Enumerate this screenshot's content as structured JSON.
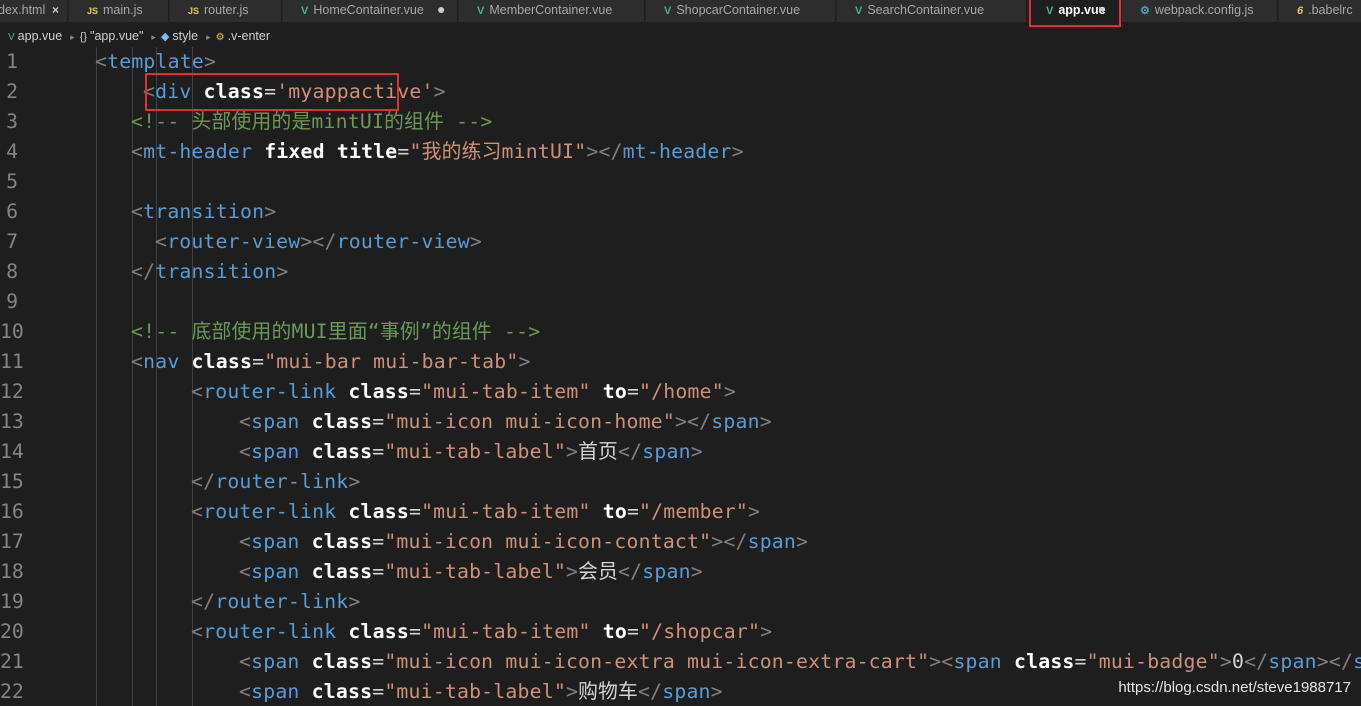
{
  "tabs": [
    {
      "label": "dex.html",
      "icon": "html-file-icon",
      "close": "×"
    },
    {
      "label": "main.js",
      "icon": "js-file-icon",
      "icon_text": "JS"
    },
    {
      "label": "router.js",
      "icon": "js-file-icon",
      "icon_text": "JS"
    },
    {
      "label": "HomeContainer.vue",
      "icon": "vue-file-icon",
      "icon_text": "V",
      "dirty": "●"
    },
    {
      "label": "MemberContainer.vue",
      "icon": "vue-file-icon",
      "icon_text": "V"
    },
    {
      "label": "ShopcarContainer.vue",
      "icon": "vue-file-icon",
      "icon_text": "V"
    },
    {
      "label": "SearchContainer.vue",
      "icon": "vue-file-icon",
      "icon_text": "V"
    },
    {
      "label": "app.vue",
      "icon": "vue-file-icon",
      "icon_text": "V",
      "close": "×",
      "active": true
    },
    {
      "label": "webpack.config.js",
      "icon": "gear-file-icon",
      "icon_text": "⚙"
    },
    {
      "label": ".babelrc",
      "icon": "babel-file-icon",
      "icon_text": "6"
    }
  ],
  "breadcrumb": {
    "file_icon": "V",
    "file": "app.vue",
    "block_icon": "{}",
    "block": "\"app.vue\"",
    "style_icon": "◆",
    "style": "style",
    "selector_icon": "⚙",
    "selector": ".v-enter",
    "separator": "▸"
  },
  "colors": {
    "background": "#1e1e1e",
    "tag": "#569cd6",
    "string": "#ce9178",
    "comment": "#6a9955",
    "attribute": "#ffffff",
    "highlight_box": "#e03030"
  },
  "code": {
    "lines": [
      {
        "num": "1",
        "tokens": [
          [
            "p",
            "<"
          ],
          [
            "t",
            "template"
          ],
          [
            "p",
            ">"
          ]
        ]
      },
      {
        "num": "2",
        "tokens": [
          [
            "p",
            "<"
          ],
          [
            "t",
            "div"
          ],
          [
            "x",
            " "
          ],
          [
            "a",
            "class"
          ],
          [
            "e",
            "="
          ],
          [
            "s",
            "'myappactive'"
          ],
          [
            "p",
            ">"
          ]
        ]
      },
      {
        "num": "3",
        "tokens": [
          [
            "c",
            "<!-- 头部使用的是mintUI的组件 -->"
          ]
        ]
      },
      {
        "num": "4",
        "tokens": [
          [
            "p",
            "<"
          ],
          [
            "t",
            "mt-header"
          ],
          [
            "x",
            " "
          ],
          [
            "a",
            "fixed"
          ],
          [
            "x",
            " "
          ],
          [
            "a",
            "title"
          ],
          [
            "e",
            "="
          ],
          [
            "s",
            "\"我的练习mintUI\""
          ],
          [
            "p",
            ">"
          ],
          [
            "p",
            "</"
          ],
          [
            "t",
            "mt-header"
          ],
          [
            "p",
            ">"
          ]
        ]
      },
      {
        "num": "5",
        "tokens": []
      },
      {
        "num": "6",
        "tokens": [
          [
            "p",
            "<"
          ],
          [
            "t",
            "transition"
          ],
          [
            "p",
            ">"
          ]
        ]
      },
      {
        "num": "7",
        "tokens": [
          [
            "p",
            "<"
          ],
          [
            "t",
            "router-view"
          ],
          [
            "p",
            ">"
          ],
          [
            "p",
            "</"
          ],
          [
            "t",
            "router-view"
          ],
          [
            "p",
            ">"
          ]
        ]
      },
      {
        "num": "8",
        "tokens": [
          [
            "p",
            "</"
          ],
          [
            "t",
            "transition"
          ],
          [
            "p",
            ">"
          ]
        ]
      },
      {
        "num": "9",
        "tokens": []
      },
      {
        "num": "10",
        "tokens": [
          [
            "c",
            "<!-- 底部使用的MUI里面“事例”的组件 -->"
          ]
        ]
      },
      {
        "num": "11",
        "tokens": [
          [
            "p",
            "<"
          ],
          [
            "t",
            "nav"
          ],
          [
            "x",
            " "
          ],
          [
            "a",
            "class"
          ],
          [
            "e",
            "="
          ],
          [
            "s",
            "\"mui-bar mui-bar-tab\""
          ],
          [
            "p",
            ">"
          ]
        ]
      },
      {
        "num": "12",
        "tokens": [
          [
            "p",
            "<"
          ],
          [
            "t",
            "router-link"
          ],
          [
            "x",
            " "
          ],
          [
            "a",
            "class"
          ],
          [
            "e",
            "="
          ],
          [
            "s",
            "\"mui-tab-item\""
          ],
          [
            "x",
            " "
          ],
          [
            "a",
            "to"
          ],
          [
            "e",
            "="
          ],
          [
            "s",
            "\"/home\""
          ],
          [
            "p",
            ">"
          ]
        ]
      },
      {
        "num": "13",
        "tokens": [
          [
            "p",
            "<"
          ],
          [
            "t",
            "span"
          ],
          [
            "x",
            " "
          ],
          [
            "a",
            "class"
          ],
          [
            "e",
            "="
          ],
          [
            "s",
            "\"mui-icon mui-icon-home\""
          ],
          [
            "p",
            ">"
          ],
          [
            "p",
            "</"
          ],
          [
            "t",
            "span"
          ],
          [
            "p",
            ">"
          ]
        ]
      },
      {
        "num": "14",
        "tokens": [
          [
            "p",
            "<"
          ],
          [
            "t",
            "span"
          ],
          [
            "x",
            " "
          ],
          [
            "a",
            "class"
          ],
          [
            "e",
            "="
          ],
          [
            "s",
            "\"mui-tab-label\""
          ],
          [
            "p",
            ">"
          ],
          [
            "x",
            "首页"
          ],
          [
            "p",
            "</"
          ],
          [
            "t",
            "span"
          ],
          [
            "p",
            ">"
          ]
        ]
      },
      {
        "num": "15",
        "tokens": [
          [
            "p",
            "</"
          ],
          [
            "t",
            "router-link"
          ],
          [
            "p",
            ">"
          ]
        ]
      },
      {
        "num": "16",
        "tokens": [
          [
            "p",
            "<"
          ],
          [
            "t",
            "router-link"
          ],
          [
            "x",
            " "
          ],
          [
            "a",
            "class"
          ],
          [
            "e",
            "="
          ],
          [
            "s",
            "\"mui-tab-item\""
          ],
          [
            "x",
            " "
          ],
          [
            "a",
            "to"
          ],
          [
            "e",
            "="
          ],
          [
            "s",
            "\"/member\""
          ],
          [
            "p",
            ">"
          ]
        ]
      },
      {
        "num": "17",
        "tokens": [
          [
            "p",
            "<"
          ],
          [
            "t",
            "span"
          ],
          [
            "x",
            " "
          ],
          [
            "a",
            "class"
          ],
          [
            "e",
            "="
          ],
          [
            "s",
            "\"mui-icon mui-icon-contact\""
          ],
          [
            "p",
            ">"
          ],
          [
            "p",
            "</"
          ],
          [
            "t",
            "span"
          ],
          [
            "p",
            ">"
          ]
        ]
      },
      {
        "num": "18",
        "tokens": [
          [
            "p",
            "<"
          ],
          [
            "t",
            "span"
          ],
          [
            "x",
            " "
          ],
          [
            "a",
            "class"
          ],
          [
            "e",
            "="
          ],
          [
            "s",
            "\"mui-tab-label\""
          ],
          [
            "p",
            ">"
          ],
          [
            "x",
            "会员"
          ],
          [
            "p",
            "</"
          ],
          [
            "t",
            "span"
          ],
          [
            "p",
            ">"
          ]
        ]
      },
      {
        "num": "19",
        "tokens": [
          [
            "p",
            "</"
          ],
          [
            "t",
            "router-link"
          ],
          [
            "p",
            ">"
          ]
        ]
      },
      {
        "num": "20",
        "tokens": [
          [
            "p",
            "<"
          ],
          [
            "t",
            "router-link"
          ],
          [
            "x",
            " "
          ],
          [
            "a",
            "class"
          ],
          [
            "e",
            "="
          ],
          [
            "s",
            "\"mui-tab-item\""
          ],
          [
            "x",
            " "
          ],
          [
            "a",
            "to"
          ],
          [
            "e",
            "="
          ],
          [
            "s",
            "\"/shopcar\""
          ],
          [
            "p",
            ">"
          ]
        ]
      },
      {
        "num": "21",
        "tokens": [
          [
            "p",
            "<"
          ],
          [
            "t",
            "span"
          ],
          [
            "x",
            " "
          ],
          [
            "a",
            "class"
          ],
          [
            "e",
            "="
          ],
          [
            "s",
            "\"mui-icon mui-icon-extra mui-icon-extra-cart\""
          ],
          [
            "p",
            ">"
          ],
          [
            "p",
            "<"
          ],
          [
            "t",
            "span"
          ],
          [
            "x",
            " "
          ],
          [
            "a",
            "class"
          ],
          [
            "e",
            "="
          ],
          [
            "s",
            "\"mui-badge\""
          ],
          [
            "p",
            ">"
          ],
          [
            "x",
            "0"
          ],
          [
            "p",
            "</"
          ],
          [
            "t",
            "span"
          ],
          [
            "p",
            "></"
          ],
          [
            "t",
            "s"
          ]
        ]
      },
      {
        "num": "22",
        "tokens": [
          [
            "p",
            "<"
          ],
          [
            "t",
            "span"
          ],
          [
            "x",
            " "
          ],
          [
            "a",
            "class"
          ],
          [
            "e",
            "="
          ],
          [
            "s",
            "\"mui-tab-label\""
          ],
          [
            "p",
            ">"
          ],
          [
            "x",
            "购物车"
          ],
          [
            "p",
            "</"
          ],
          [
            "t",
            "span"
          ],
          [
            "p",
            ">"
          ]
        ]
      }
    ]
  },
  "watermark": "https://blog.csdn.net/steve1988717"
}
